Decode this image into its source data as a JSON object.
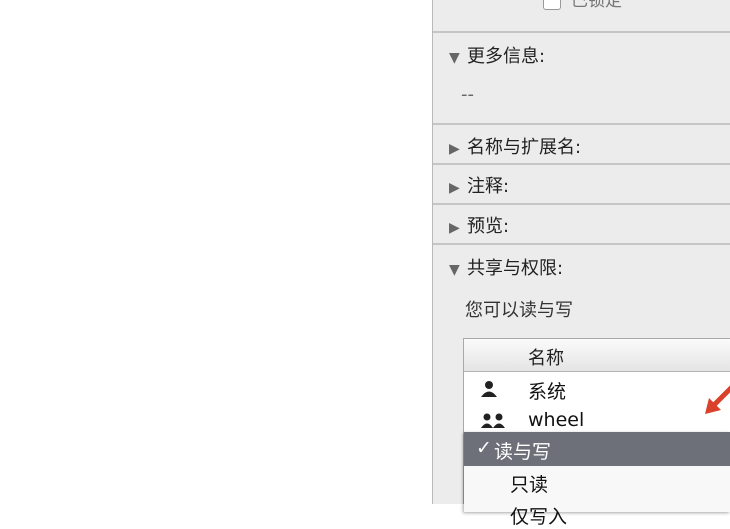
{
  "info_panel": {
    "locked_label": "已锁定",
    "sections": [
      {
        "label": "更多信息:",
        "expanded": true
      },
      {
        "label": "名称与扩展名:",
        "expanded": false
      },
      {
        "label": "注释:",
        "expanded": false
      },
      {
        "label": "预览:",
        "expanded": false
      },
      {
        "label": "共享与权限:",
        "expanded": true
      }
    ],
    "more_info_value": "--",
    "permission_summary": "您可以读与写"
  },
  "permissions_table": {
    "column_name": "名称",
    "rows": [
      {
        "name": "系统",
        "icon": "single-user-icon"
      },
      {
        "name": "wheel",
        "icon": "group-icon"
      }
    ]
  },
  "privilege_menu": {
    "check_glyph": "✓",
    "options": [
      "读与写",
      "只读",
      "仅写入"
    ],
    "selected": "读与写"
  },
  "colors": {
    "panel_bg": "#ececec",
    "menu_highlight": "#6e7079",
    "arrow": "#d9412b"
  }
}
